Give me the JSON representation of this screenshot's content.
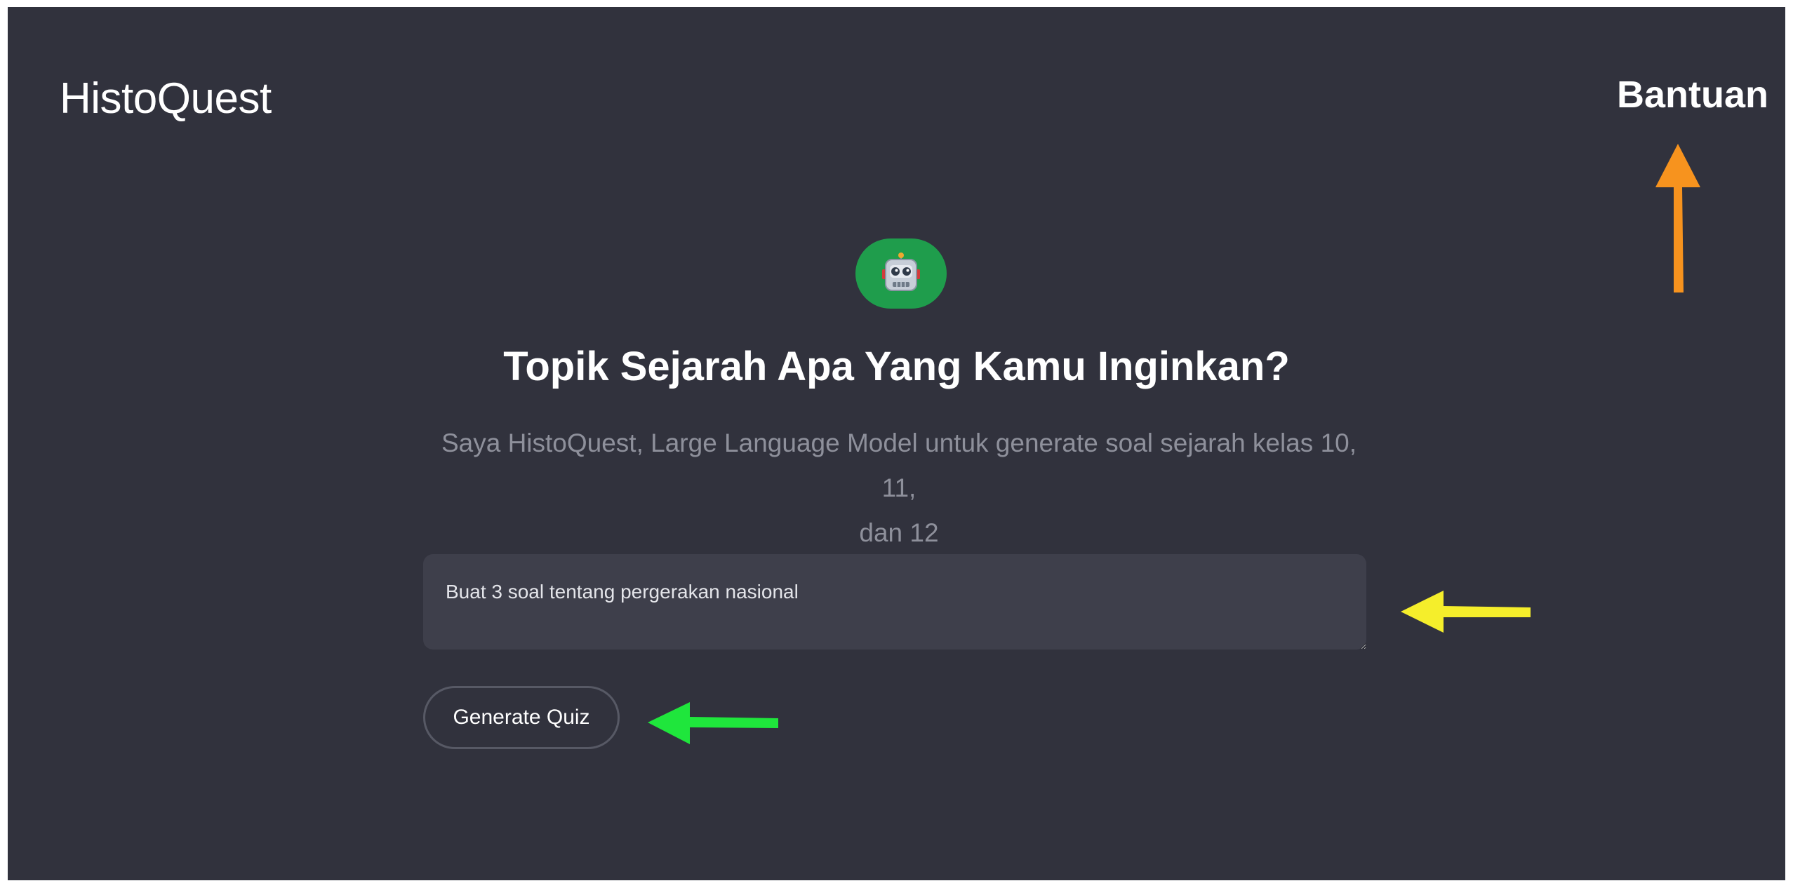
{
  "header": {
    "brand": "HistoQuest",
    "help_link": "Bantuan"
  },
  "hero": {
    "avatar_icon": "robot-icon",
    "avatar_color": "#1f9d4c",
    "headline": "Topik Sejarah Apa Yang Kamu Inginkan?",
    "subtitle_line1": "Saya HistoQuest, Large Language Model untuk generate soal sejarah kelas 10, 11,",
    "subtitle_line2": "dan 12"
  },
  "prompt": {
    "value": "Buat 3 soal tentang pergerakan nasional"
  },
  "actions": {
    "generate_label": "Generate Quiz"
  },
  "annotations": {
    "help_arrow_color": "#f7931e",
    "prompt_arrow_color": "#f5ee2b",
    "button_arrow_color": "#1fe63c"
  },
  "theme": {
    "background": "#31323d",
    "input_background": "#3e3f4b",
    "muted_text": "#8e909b"
  }
}
